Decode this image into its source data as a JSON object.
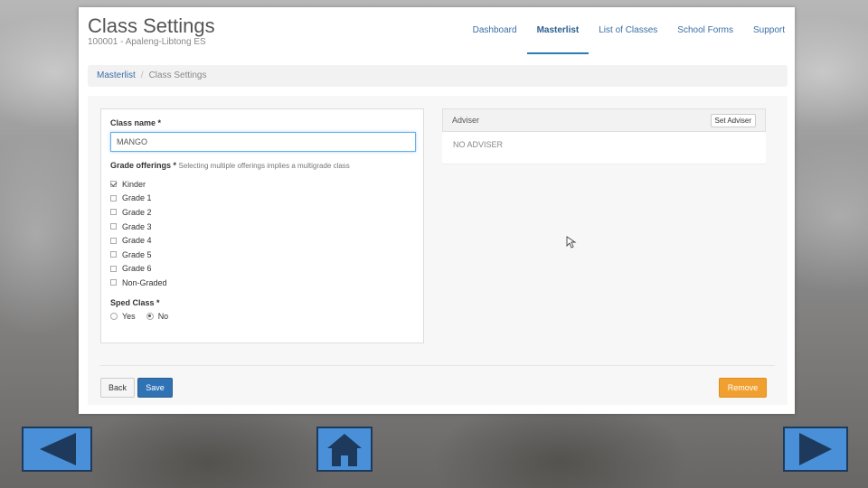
{
  "header": {
    "title": "Class Settings",
    "subtitle": "100001 - Apaleng-Libtong ES"
  },
  "nav": {
    "items": [
      {
        "label": "Dashboard",
        "active": false
      },
      {
        "label": "Masterlist",
        "active": true
      },
      {
        "label": "List of Classes",
        "active": false
      },
      {
        "label": "School Forms",
        "active": false
      },
      {
        "label": "Support",
        "active": false
      }
    ]
  },
  "breadcrumb": {
    "link": "Masterlist",
    "separator": "/",
    "current": "Class Settings"
  },
  "form": {
    "class_name_label": "Class name *",
    "class_name_value": "MANGO",
    "grade_offerings_label": "Grade offerings *",
    "grade_offerings_hint": "Selecting multiple offerings implies a multigrade class",
    "grades": [
      {
        "label": "Kinder",
        "checked": true
      },
      {
        "label": "Grade 1",
        "checked": false
      },
      {
        "label": "Grade 2",
        "checked": false
      },
      {
        "label": "Grade 3",
        "checked": false
      },
      {
        "label": "Grade 4",
        "checked": false
      },
      {
        "label": "Grade 5",
        "checked": false
      },
      {
        "label": "Grade 6",
        "checked": false
      },
      {
        "label": "Non-Graded",
        "checked": false
      }
    ],
    "sped_label": "Sped Class *",
    "sped_options": [
      {
        "label": "Yes",
        "checked": false
      },
      {
        "label": "No",
        "checked": true
      }
    ]
  },
  "adviser": {
    "title": "Adviser",
    "set_button": "Set Adviser",
    "value": "NO ADVISER"
  },
  "buttons": {
    "back": "Back",
    "save": "Save",
    "remove": "Remove"
  },
  "colors": {
    "primary": "#2f73b5",
    "warning": "#f0a030",
    "link": "#3a6ea5",
    "slide_nav": "#4a90d9"
  },
  "slide_nav": {
    "prev_icon": "left-triangle-icon",
    "home_icon": "home-icon",
    "next_icon": "right-triangle-icon"
  }
}
